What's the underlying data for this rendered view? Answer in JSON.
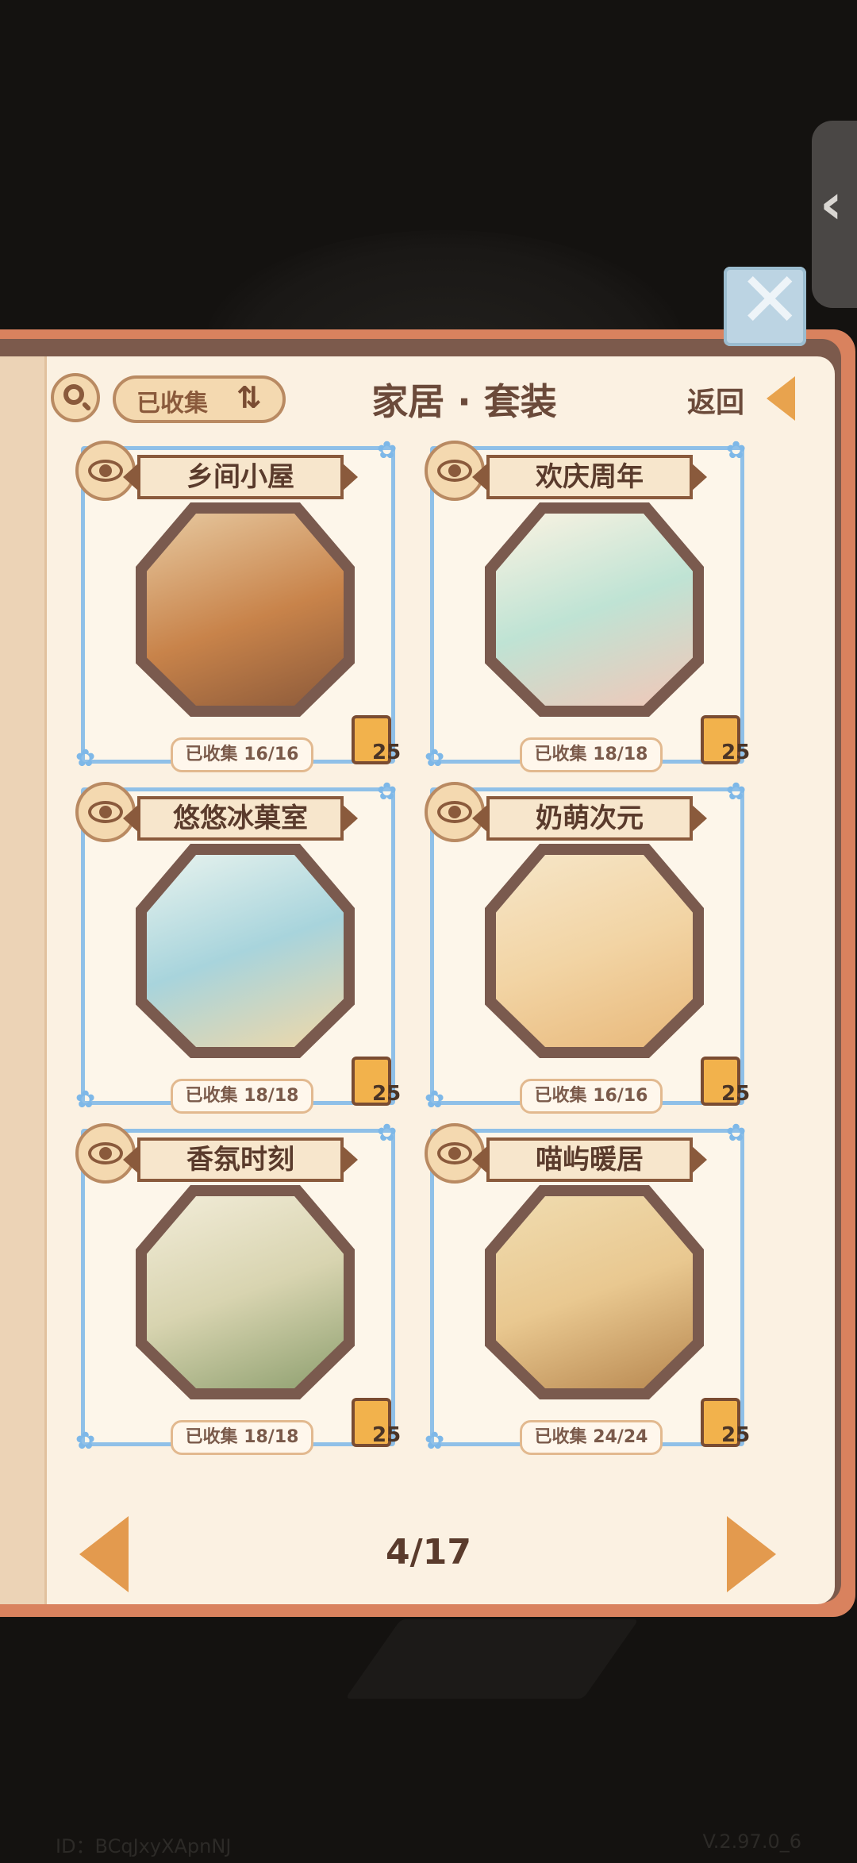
{
  "header": {
    "filter_label": "已收集",
    "title": "家居 · 套装",
    "back_label": "返回"
  },
  "cards": [
    {
      "title": "乡间小屋",
      "collected": "已收集 16/16",
      "book_count": "25",
      "floor_color": "#c8834a"
    },
    {
      "title": "欢庆周年",
      "collected": "已收集 18/18",
      "book_count": "25",
      "floor_color": "#f3e8d0"
    },
    {
      "title": "悠悠冰菓室",
      "collected": "已收集 18/18",
      "book_count": "25",
      "floor_color": "#cfe7e8"
    },
    {
      "title": "奶萌次元",
      "collected": "已收集 16/16",
      "book_count": "25",
      "floor_color": "#f2d4a4"
    },
    {
      "title": "香氛时刻",
      "collected": "已收集 18/18",
      "book_count": "25",
      "floor_color": "#e9e1c8"
    },
    {
      "title": "喵屿暖居",
      "collected": "已收集 24/24",
      "book_count": "25",
      "floor_color": "#e9c890"
    }
  ],
  "pager": {
    "text": "4/17"
  },
  "footer": {
    "id": "ID：BCqJxyXApnNJ",
    "version": "V.2.97.0_6"
  },
  "colors": {
    "card_border": "#8fc0e8",
    "accent_orange": "#e39a4e",
    "page_bg": "#fbf1e2"
  }
}
